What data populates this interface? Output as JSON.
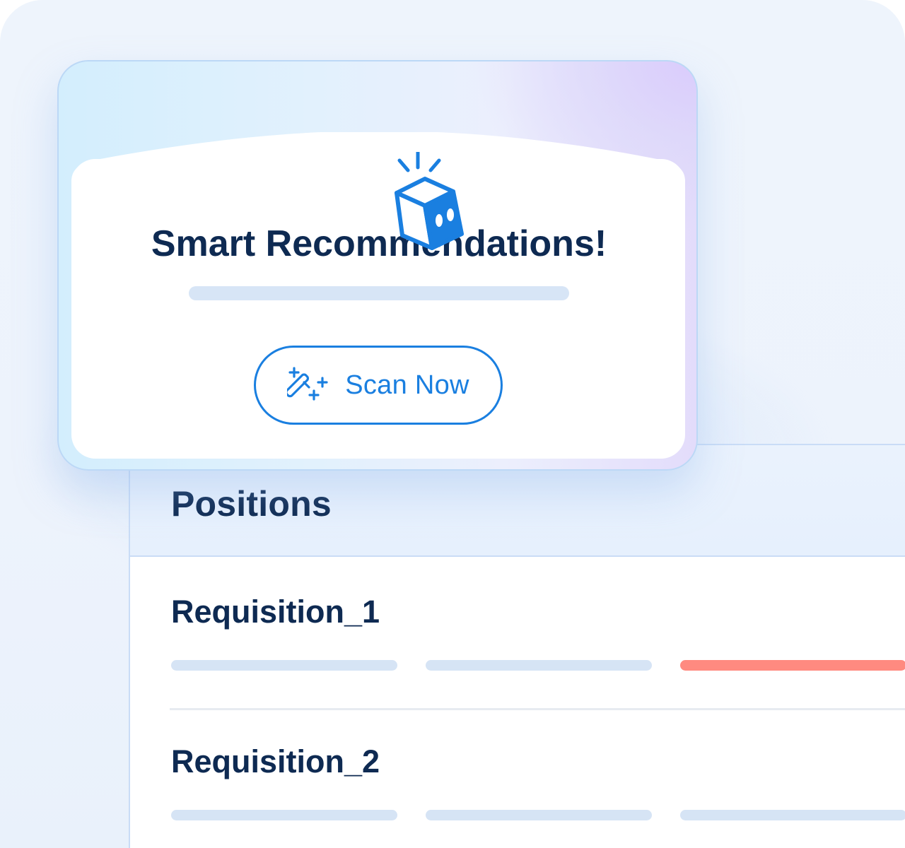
{
  "card": {
    "title": "Smart Recommendations!",
    "scan_button_label": "Scan Now",
    "icons": [
      "robot-cube-icon",
      "magic-wand-icon"
    ]
  },
  "positions": {
    "title": "Positions",
    "rows": [
      {
        "name": "Requisition_1",
        "status_bar_colors": [
          "#d6e4f5",
          "#d6e4f5",
          "#ff8a80"
        ]
      },
      {
        "name": "Requisition_2",
        "status_bar_colors": [
          "#d6e4f5",
          "#d6e4f5",
          "#d6e4f5"
        ]
      }
    ]
  },
  "colors": {
    "accent": "#1a7fe0",
    "heading": "#0e2a52",
    "alert": "#ff8a80",
    "placeholder": "#d6e4f5"
  }
}
